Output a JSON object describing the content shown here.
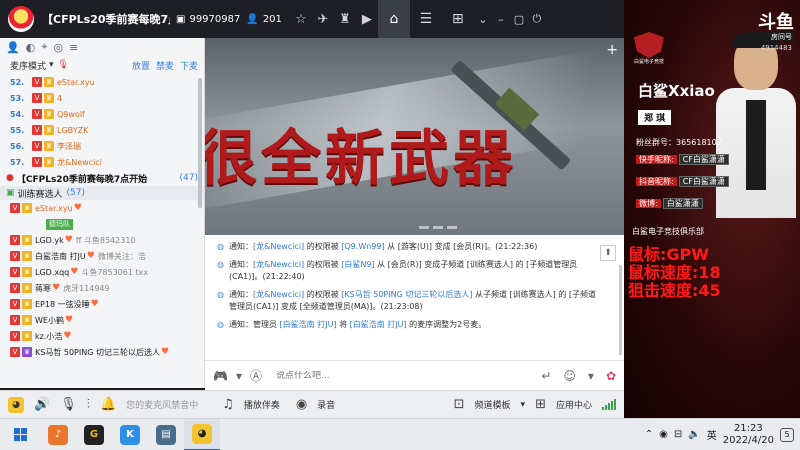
{
  "topbar": {
    "title": "【CFPLs20季前赛每晚7点开始",
    "room_id": "99970987",
    "online": "201",
    "icons": [
      "monitor-icon",
      "person-icon",
      "star-icon",
      "plane-icon",
      "shirt-icon",
      "video-icon",
      "home-icon",
      "list-icon",
      "gamepad-icon",
      "minimize-icon",
      "maximize-icon",
      "power-icon"
    ]
  },
  "left": {
    "mode_label": "麦序模式",
    "actions": [
      "放置",
      "禁麦",
      "下麦"
    ],
    "queue": [
      {
        "num": "52.",
        "badge": "2",
        "name": "eStar.xyu",
        "sub": ""
      },
      {
        "num": "53.",
        "badge": "",
        "name": "4",
        "sub": ""
      },
      {
        "num": "54.",
        "badge": "",
        "name": "Q9wolf",
        "sub": ""
      },
      {
        "num": "55.",
        "badge": "",
        "name": "LGBYZK",
        "sub": ""
      },
      {
        "num": "56.",
        "badge": "",
        "name": "李泽瑞",
        "sub": ""
      },
      {
        "num": "57.",
        "badge": "",
        "name": "龙&Newcici",
        "sub": ""
      }
    ],
    "channel_title": "【CFPLs20季前赛每晚7点开始",
    "channel_count": "(47)",
    "sub_channel": "训练赛选人",
    "sub_count": "(57)",
    "members": [
      {
        "name": "eStar.xyu",
        "sub": "",
        "badge_green": "德玛队"
      },
      {
        "name": "LGD.yk",
        "sub": "ff 斗鱼8542310"
      },
      {
        "name": "白鲨浩南 打JU",
        "sub": "微博关注：浩"
      },
      {
        "name": "LGD.xqq",
        "sub": "斗鱼7853061 txx"
      },
      {
        "name": "蒋寒",
        "sub": "虎牙114949"
      },
      {
        "name": "EP18 一弦没睡",
        "sub": ""
      },
      {
        "name": "WE小鹤",
        "sub": ""
      },
      {
        "name": "kz.小浩",
        "sub": ""
      },
      {
        "name": "KS马哲 50PING 切记三轮以后选人",
        "sub": ""
      }
    ]
  },
  "banner": {
    "text": "很全新武器",
    "plus": "+"
  },
  "messages": [
    {
      "parts": [
        "通知：",
        "[龙&Newcici]",
        " 的权限被 ",
        "[Q9.Wn99]",
        " 从 [游客(U)] 变成 [会员(R)]。(21:22:36)"
      ]
    },
    {
      "parts": [
        "通知：",
        "[龙&Newcici]",
        " 的权限被 ",
        "[白鲨N9]",
        " 从 [会员(R)] 变成子频道 [训练赛选人] 的 [子频道管理员(CA1)]。(21:22:40)"
      ]
    },
    {
      "parts": [
        "通知：",
        "[龙&Newcici]",
        " 的权限被 ",
        "[KS马哲 50PING 切记三轮以后选人]",
        " 从子频道 [训练赛选人] 的 [子频道管理员(CA1)] 变成 [全频道管理员(MA)]。(21:23:08)"
      ]
    },
    {
      "parts": [
        "通知：管理员 ",
        "[白鲨浩南 打JU]",
        " 将 ",
        "[白鲨浩南 打JU]",
        " 的麦序调整为2号麦。"
      ]
    }
  ],
  "input": {
    "placeholder": "说点什么吧..."
  },
  "bottombar": {
    "mute_text": "您的麦克风禁音中",
    "play_label": "播放伴奏",
    "record_label": "录音",
    "template_label": "频道模板",
    "app_center": "应用中心"
  },
  "right": {
    "platform": "斗鱼",
    "platform_sub": "房间号",
    "room": "4914483",
    "club_name_small": "白鲨电子竞技",
    "streamer_name": "白鲨Xxiao",
    "real_name": "郑 琪",
    "fans_group": "粉丝群号：365618102",
    "kuaishou_label": "快手昵称:",
    "kuaishou_value": "CF白鲨潇潇",
    "douyin_label": "抖音昵称:",
    "douyin_value": "CF白鲨潇潇",
    "weibo_label": "微博:",
    "weibo_value": "白鲨潇潇",
    "club": "白鲨电子竞技俱乐部",
    "stats": [
      "鼠标:GPW",
      "鼠标速度:18",
      "狙击速度:45"
    ]
  },
  "taskbar": {
    "time": "21:23",
    "date": "2022/4/20",
    "lang": "英",
    "notif_count": "5"
  },
  "colors": {
    "topbar_bg": "#1d1f24",
    "accent_blue": "#2e7bd6",
    "stat_red": "#ff1a1a"
  }
}
